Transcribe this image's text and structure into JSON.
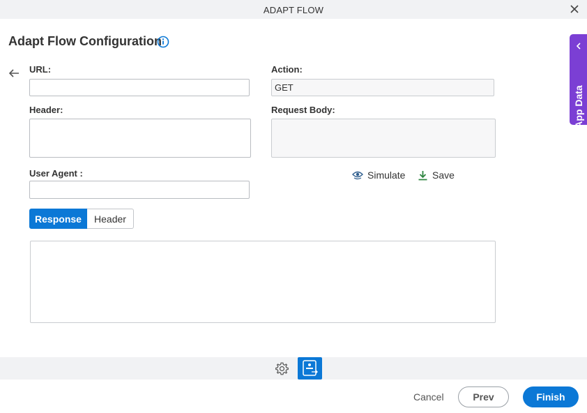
{
  "window": {
    "title": "ADAPT FLOW",
    "close_icon": "close-icon"
  },
  "page": {
    "heading": "Adapt Flow Configuration",
    "info_icon": "info-icon",
    "back_icon": "back-arrow-icon"
  },
  "form": {
    "url": {
      "label": "URL:",
      "value": ""
    },
    "action": {
      "label": "Action:",
      "value": "GET"
    },
    "header": {
      "label": "Header:",
      "value": ""
    },
    "request_body": {
      "label": "Request Body:",
      "value": ""
    },
    "user_agent": {
      "label": "User Agent :",
      "value": ""
    }
  },
  "actions": {
    "simulate_label": "Simulate",
    "save_label": "Save"
  },
  "response_tabs": [
    {
      "label": "Response",
      "active": true
    },
    {
      "label": "Header",
      "active": false
    }
  ],
  "side_panel": {
    "label": "App Data"
  },
  "toolbar": {
    "settings_icon": "gear-icon",
    "flow_icon": "adapt-flow-icon"
  },
  "footer": {
    "cancel_label": "Cancel",
    "prev_label": "Prev",
    "finish_label": "Finish"
  },
  "colors": {
    "primary": "#0b78d6",
    "side_tab": "#7b3fd4",
    "save_icon": "#2e8540"
  }
}
